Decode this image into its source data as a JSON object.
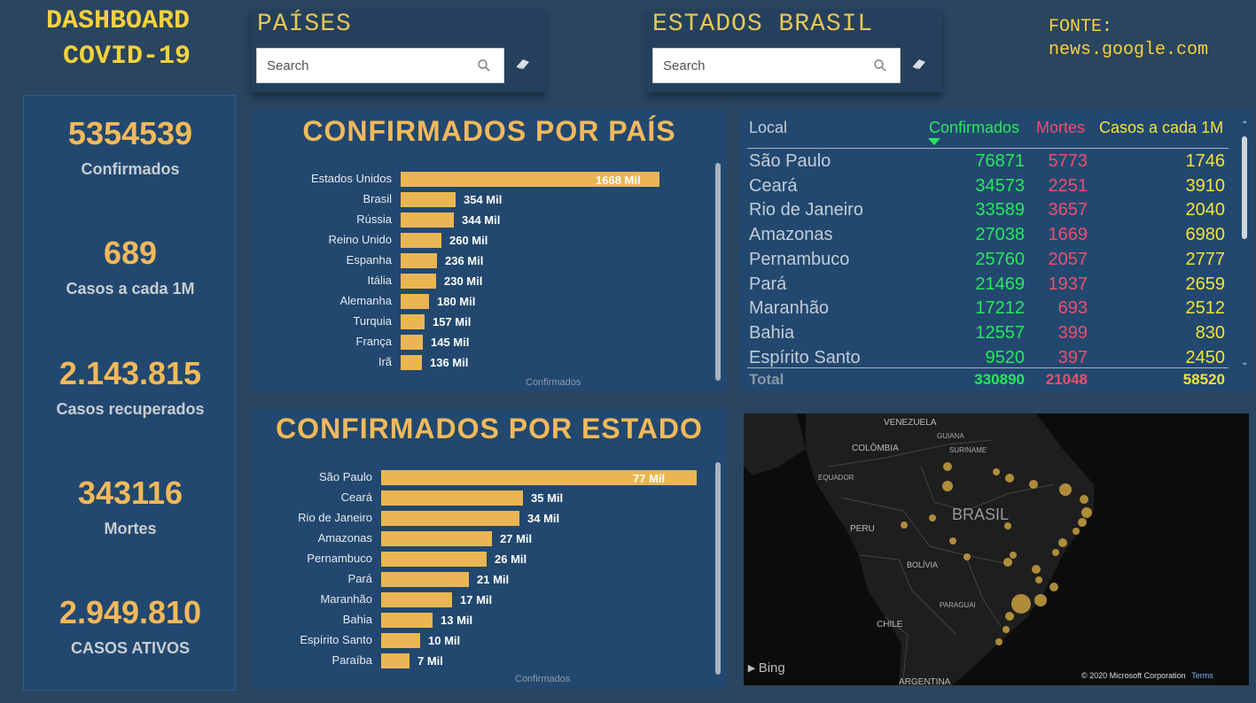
{
  "header": {
    "title_line1": "DASHBOARD",
    "title_line2": "COVID-19",
    "source_label": "FONTE:",
    "source_url": "news.google.com"
  },
  "slicers": {
    "countries": {
      "title": "PAÍSES",
      "placeholder": "Search"
    },
    "states": {
      "title": "ESTADOS BRASIL",
      "placeholder": "Search"
    }
  },
  "kpis": [
    {
      "value": "5354539",
      "label": "Confirmados"
    },
    {
      "value": "689",
      "label": "Casos a cada 1M"
    },
    {
      "value": "2.143.815",
      "label": "Casos recuperados"
    },
    {
      "value": "343116",
      "label": "Mortes"
    },
    {
      "value": "2.949.810",
      "label": "CASOS ATIVOS"
    }
  ],
  "chart_data": [
    {
      "type": "bar",
      "orientation": "horizontal",
      "title": "CONFIRMADOS POR PAÍS",
      "xlabel": "Confirmados",
      "categories": [
        "Estados Unidos",
        "Brasil",
        "Rússia",
        "Reino Unido",
        "Espanha",
        "Itália",
        "Alemanha",
        "Turquia",
        "França",
        "Irã"
      ],
      "values": [
        1668000,
        354000,
        344000,
        260000,
        236000,
        230000,
        180000,
        157000,
        145000,
        136000
      ],
      "labels": [
        "1668 Mil",
        "354 Mil",
        "344 Mil",
        "260 Mil",
        "236 Mil",
        "230 Mil",
        "180 Mil",
        "157 Mil",
        "145 Mil",
        "136 Mil"
      ],
      "color": "#eab653"
    },
    {
      "type": "bar",
      "orientation": "horizontal",
      "title": "CONFIRMADOS POR ESTADO",
      "xlabel": "Confirmados",
      "categories": [
        "São Paulo",
        "Ceará",
        "Rio de Janeiro",
        "Amazonas",
        "Pernambuco",
        "Pará",
        "Maranhão",
        "Bahia",
        "Espírito Santo",
        "Paraíba"
      ],
      "values": [
        76871,
        34573,
        33589,
        27038,
        25760,
        21469,
        17212,
        12557,
        9520,
        7000
      ],
      "labels": [
        "77 Mil",
        "35 Mil",
        "34 Mil",
        "27 Mil",
        "26 Mil",
        "21 Mil",
        "17 Mil",
        "13 Mil",
        "10 Mil",
        "7 Mil"
      ],
      "color": "#eab653"
    }
  ],
  "table": {
    "headers": {
      "local": "Local",
      "confirmados": "Confirmados",
      "mortes": "Mortes",
      "casos": "Casos a cada 1M"
    },
    "rows": [
      {
        "local": "São Paulo",
        "confirmados": "76871",
        "mortes": "5773",
        "casos": "1746"
      },
      {
        "local": "Ceará",
        "confirmados": "34573",
        "mortes": "2251",
        "casos": "3910"
      },
      {
        "local": "Rio de Janeiro",
        "confirmados": "33589",
        "mortes": "3657",
        "casos": "2040"
      },
      {
        "local": "Amazonas",
        "confirmados": "27038",
        "mortes": "1669",
        "casos": "6980"
      },
      {
        "local": "Pernambuco",
        "confirmados": "25760",
        "mortes": "2057",
        "casos": "2777"
      },
      {
        "local": "Pará",
        "confirmados": "21469",
        "mortes": "1937",
        "casos": "2659"
      },
      {
        "local": "Maranhão",
        "confirmados": "17212",
        "mortes": "693",
        "casos": "2512"
      },
      {
        "local": "Bahia",
        "confirmados": "12557",
        "mortes": "399",
        "casos": "830"
      },
      {
        "local": "Espírito Santo",
        "confirmados": "9520",
        "mortes": "397",
        "casos": "2450"
      }
    ],
    "total": {
      "label": "Total",
      "confirmados": "330890",
      "mortes": "21048",
      "casos": "58520"
    }
  },
  "map": {
    "country_label": "BRASIL",
    "labels": [
      "VENEZUELA",
      "GUIANA",
      "SURINAME",
      "COLÔMBIA",
      "EQUADOR",
      "PERU",
      "BOLÍVIA",
      "PARAGUAI",
      "CHILE",
      "ARGENTINA"
    ],
    "provider": "Bing",
    "copyright": "© 2020 Microsoft Corporation",
    "terms": "Terms",
    "bubble_color": "#c9a03e"
  },
  "colors": {
    "background": "#2a4560",
    "panel": "#22486f",
    "accent_orange": "#f2b95a",
    "title_yellow": "#f5d23c",
    "confirmed_green": "#27e85c",
    "deaths_red": "#ee4f6e",
    "per_million_yellow": "#f2e33c"
  }
}
